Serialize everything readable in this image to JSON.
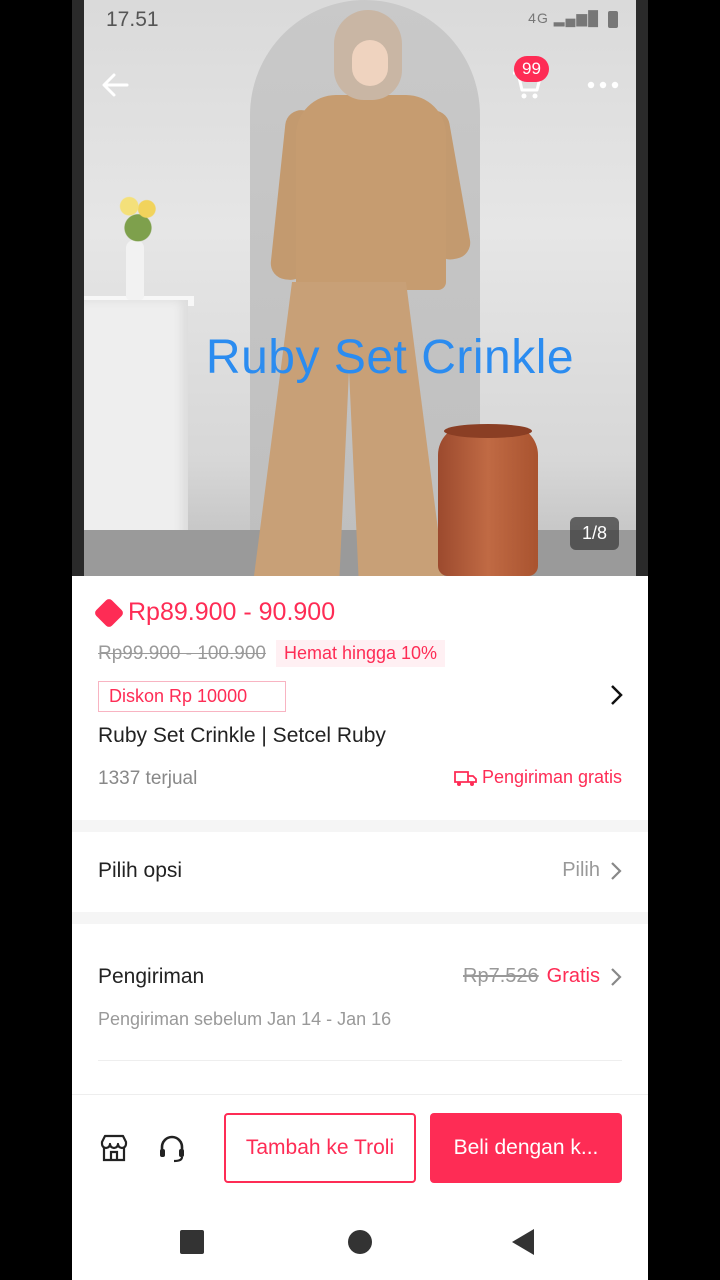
{
  "status_bar": {
    "time": "17.51",
    "signal": "4G"
  },
  "header": {
    "cart_count": "99"
  },
  "hero": {
    "overlay_text": "Ruby Set Crinkle",
    "image_counter": "1/8"
  },
  "product": {
    "price_range": "Rp89.900 - 90.900",
    "original_price": "Rp99.900 - 100.900",
    "savings": "Hemat hingga 10%",
    "coupon": "Diskon Rp 10000",
    "title": "Ruby Set Crinkle | Setcel Ruby",
    "sold": "1337 terjual",
    "shipping_badge": "Pengiriman gratis"
  },
  "options": {
    "label": "Pilih opsi",
    "action": "Pilih"
  },
  "shipping": {
    "label": "Pengiriman",
    "old_price": "Rp7.526",
    "price": "Gratis",
    "eta": "Pengiriman sebelum Jan 14 - Jan 16"
  },
  "actions": {
    "add_to_cart": "Tambah ke Troli",
    "buy": "Beli dengan k..."
  },
  "colors": {
    "accent": "#fe2c55",
    "watermark": "#2b8cf0"
  }
}
